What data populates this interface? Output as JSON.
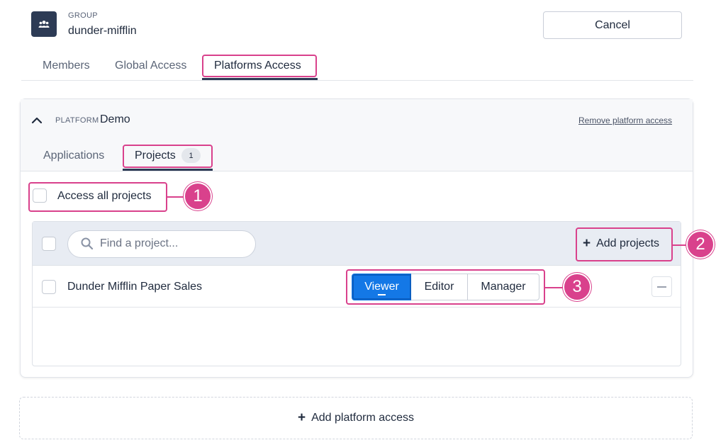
{
  "header": {
    "kicker": "GROUP",
    "group_name": "dunder-mifflin",
    "cancel_label": "Cancel"
  },
  "top_tabs": [
    {
      "label": "Members",
      "active": false
    },
    {
      "label": "Global Access",
      "active": false
    },
    {
      "label": "Platforms Access",
      "active": true
    }
  ],
  "platform": {
    "kicker": "PLATFORM",
    "name": "Demo",
    "remove_label": "Remove platform access",
    "sub_tabs": [
      {
        "label": "Applications",
        "active": false
      },
      {
        "label": "Projects",
        "active": true,
        "count": "1"
      }
    ],
    "access_all_label": "Access all projects",
    "access_all_checked": false,
    "search": {
      "placeholder": "Find a project..."
    },
    "add_projects_label": "Add projects",
    "projects": [
      {
        "name": "Dunder Mifflin Paper Sales",
        "checked": false,
        "roles": [
          "Viewer",
          "Editor",
          "Manager"
        ],
        "selected_role": "Viewer"
      }
    ]
  },
  "add_platform_label": "Add platform access",
  "annotations": [
    "1",
    "2",
    "3"
  ],
  "colors": {
    "accent": "#1478e6",
    "annotation": "#d9418c",
    "dark": "#2d3b55"
  }
}
